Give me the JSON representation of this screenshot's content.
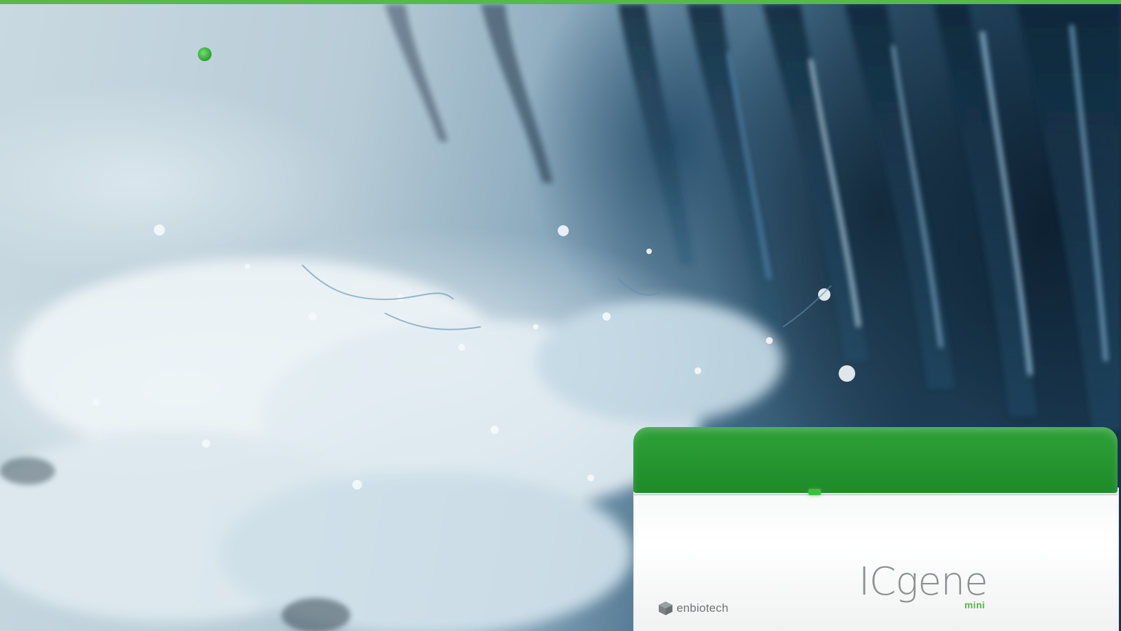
{
  "page": {
    "accent_color": "#57b947"
  },
  "photo": {
    "subject": "water-splash-icon"
  },
  "device": {
    "brand": "enbiotech",
    "product_name": "ICgene",
    "product_variant": "mini",
    "lid_color": "#24952f",
    "led_color": "#3cbf3f"
  }
}
